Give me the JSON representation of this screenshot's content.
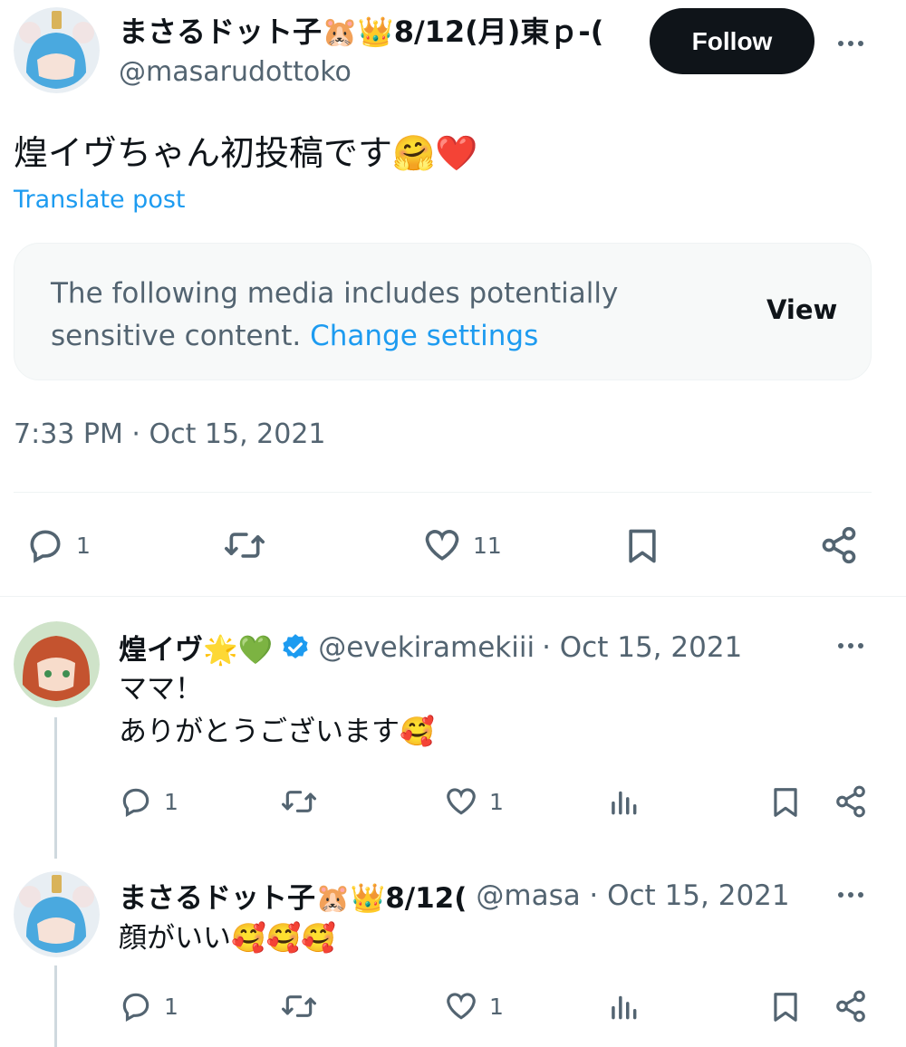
{
  "post": {
    "author_name": "まさるドット子🐹👑8/12(月)東ｐ-(",
    "author_handle": "@masarudottoko",
    "follow_label": "Follow",
    "text": "煌イヴちゃん初投稿です🤗❤️",
    "translate_label": "Translate post",
    "sensitive_notice": "The following media includes potentially sensitive content.",
    "change_settings_label": "Change settings",
    "view_label": "View",
    "timestamp": "7:33 PM · Oct 15, 2021",
    "replies_count": "1",
    "likes_count": "11"
  },
  "replies": [
    {
      "name": "煌イヴ🌟💚",
      "handle": "@evekiramekiii",
      "date": "· Oct 15, 2021",
      "line1": "ママ！",
      "line2": "ありがとうございます🥰",
      "replies_count": "1",
      "likes_count": "1",
      "verified": true
    },
    {
      "name": "まさるドット子🐹👑8/12(",
      "handle": "@masa",
      "date": "· Oct 15, 2021",
      "line1": "顔がいい🥰🥰🥰",
      "replies_count": "1",
      "likes_count": "1",
      "verified": false
    }
  ],
  "colors": {
    "text": "#0f1419",
    "secondary": "#536471",
    "link": "#1d9bf0",
    "verified": "#1d9bf0"
  }
}
